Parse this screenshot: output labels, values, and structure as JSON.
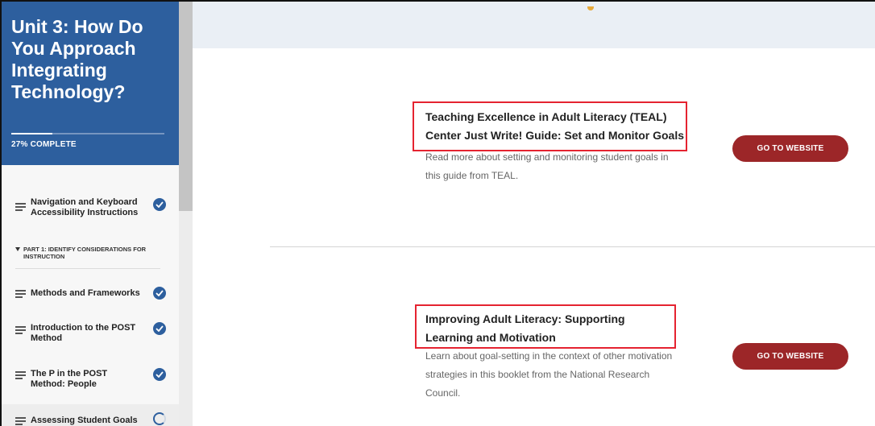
{
  "sidebar": {
    "course_title": "Unit 3: How Do You Approach Integrating Technology?",
    "progress_percent": 27,
    "progress_label": "27% COMPLETE",
    "lessons": [
      {
        "label": "Navigation and Keyboard Accessibility Instructions",
        "status": "complete"
      },
      {
        "label": "Methods and Frameworks",
        "status": "complete"
      },
      {
        "label": "Introduction to the POST Method",
        "status": "complete"
      },
      {
        "label": "The P in the POST Method: People",
        "status": "complete"
      },
      {
        "label": "Assessing Student Goals",
        "status": "in-progress"
      }
    ],
    "section_label": "PART 1: IDENTIFY CONSIDERATIONS FOR INSTRUCTION"
  },
  "main": {
    "resources": [
      {
        "title": "Teaching Excellence in Adult Literacy (TEAL) Center Just Write! Guide: Set and Monitor Goals",
        "description": "Read more about setting and monitoring student goals in this guide from TEAL.",
        "button_label": "GO TO WEBSITE"
      },
      {
        "title": "Improving Adult Literacy: Supporting Learning and Motivation",
        "description": "Learn about goal-setting in the context of other motivation strategies in this booklet from the National Research Council.",
        "button_label": "GO TO WEBSITE"
      }
    ]
  },
  "colors": {
    "brand_blue": "#2d5f9e",
    "button_red": "#9c2628",
    "highlight_red": "#e52330"
  }
}
